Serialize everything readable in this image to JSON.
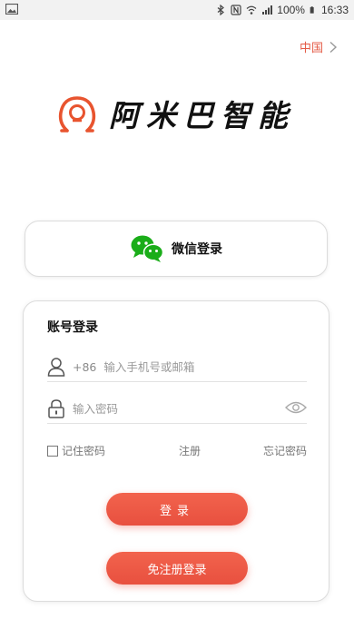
{
  "status_bar": {
    "battery": "100%",
    "time": "16:33",
    "icons": [
      "image-icon",
      "bluetooth-icon",
      "nfc-icon",
      "wifi-icon",
      "signal-icon",
      "battery-icon"
    ]
  },
  "region": {
    "label": "中国",
    "icon": "chevron-right-icon"
  },
  "logo": {
    "text": "阿米巴智能",
    "icon": "omega-logo-icon"
  },
  "wechat": {
    "label": "微信登录",
    "icon": "wechat-icon"
  },
  "account": {
    "title": "账号登录",
    "phone": {
      "prefix": "+86",
      "placeholder": "输入手机号或邮箱",
      "value": "",
      "icon": "user-icon"
    },
    "password": {
      "placeholder": "输入密码",
      "value": "",
      "icon": "lock-icon",
      "toggle_icon": "eye-icon"
    },
    "remember_label": "记住密码",
    "register_label": "注册",
    "forgot_label": "忘记密码",
    "login_button": "登录",
    "quick_login_button": "免注册登录"
  },
  "colors": {
    "accent": "#e8503f",
    "region_text": "#e45a45",
    "wechat_green": "#1aad19",
    "logo_orange": "#e8542f"
  }
}
